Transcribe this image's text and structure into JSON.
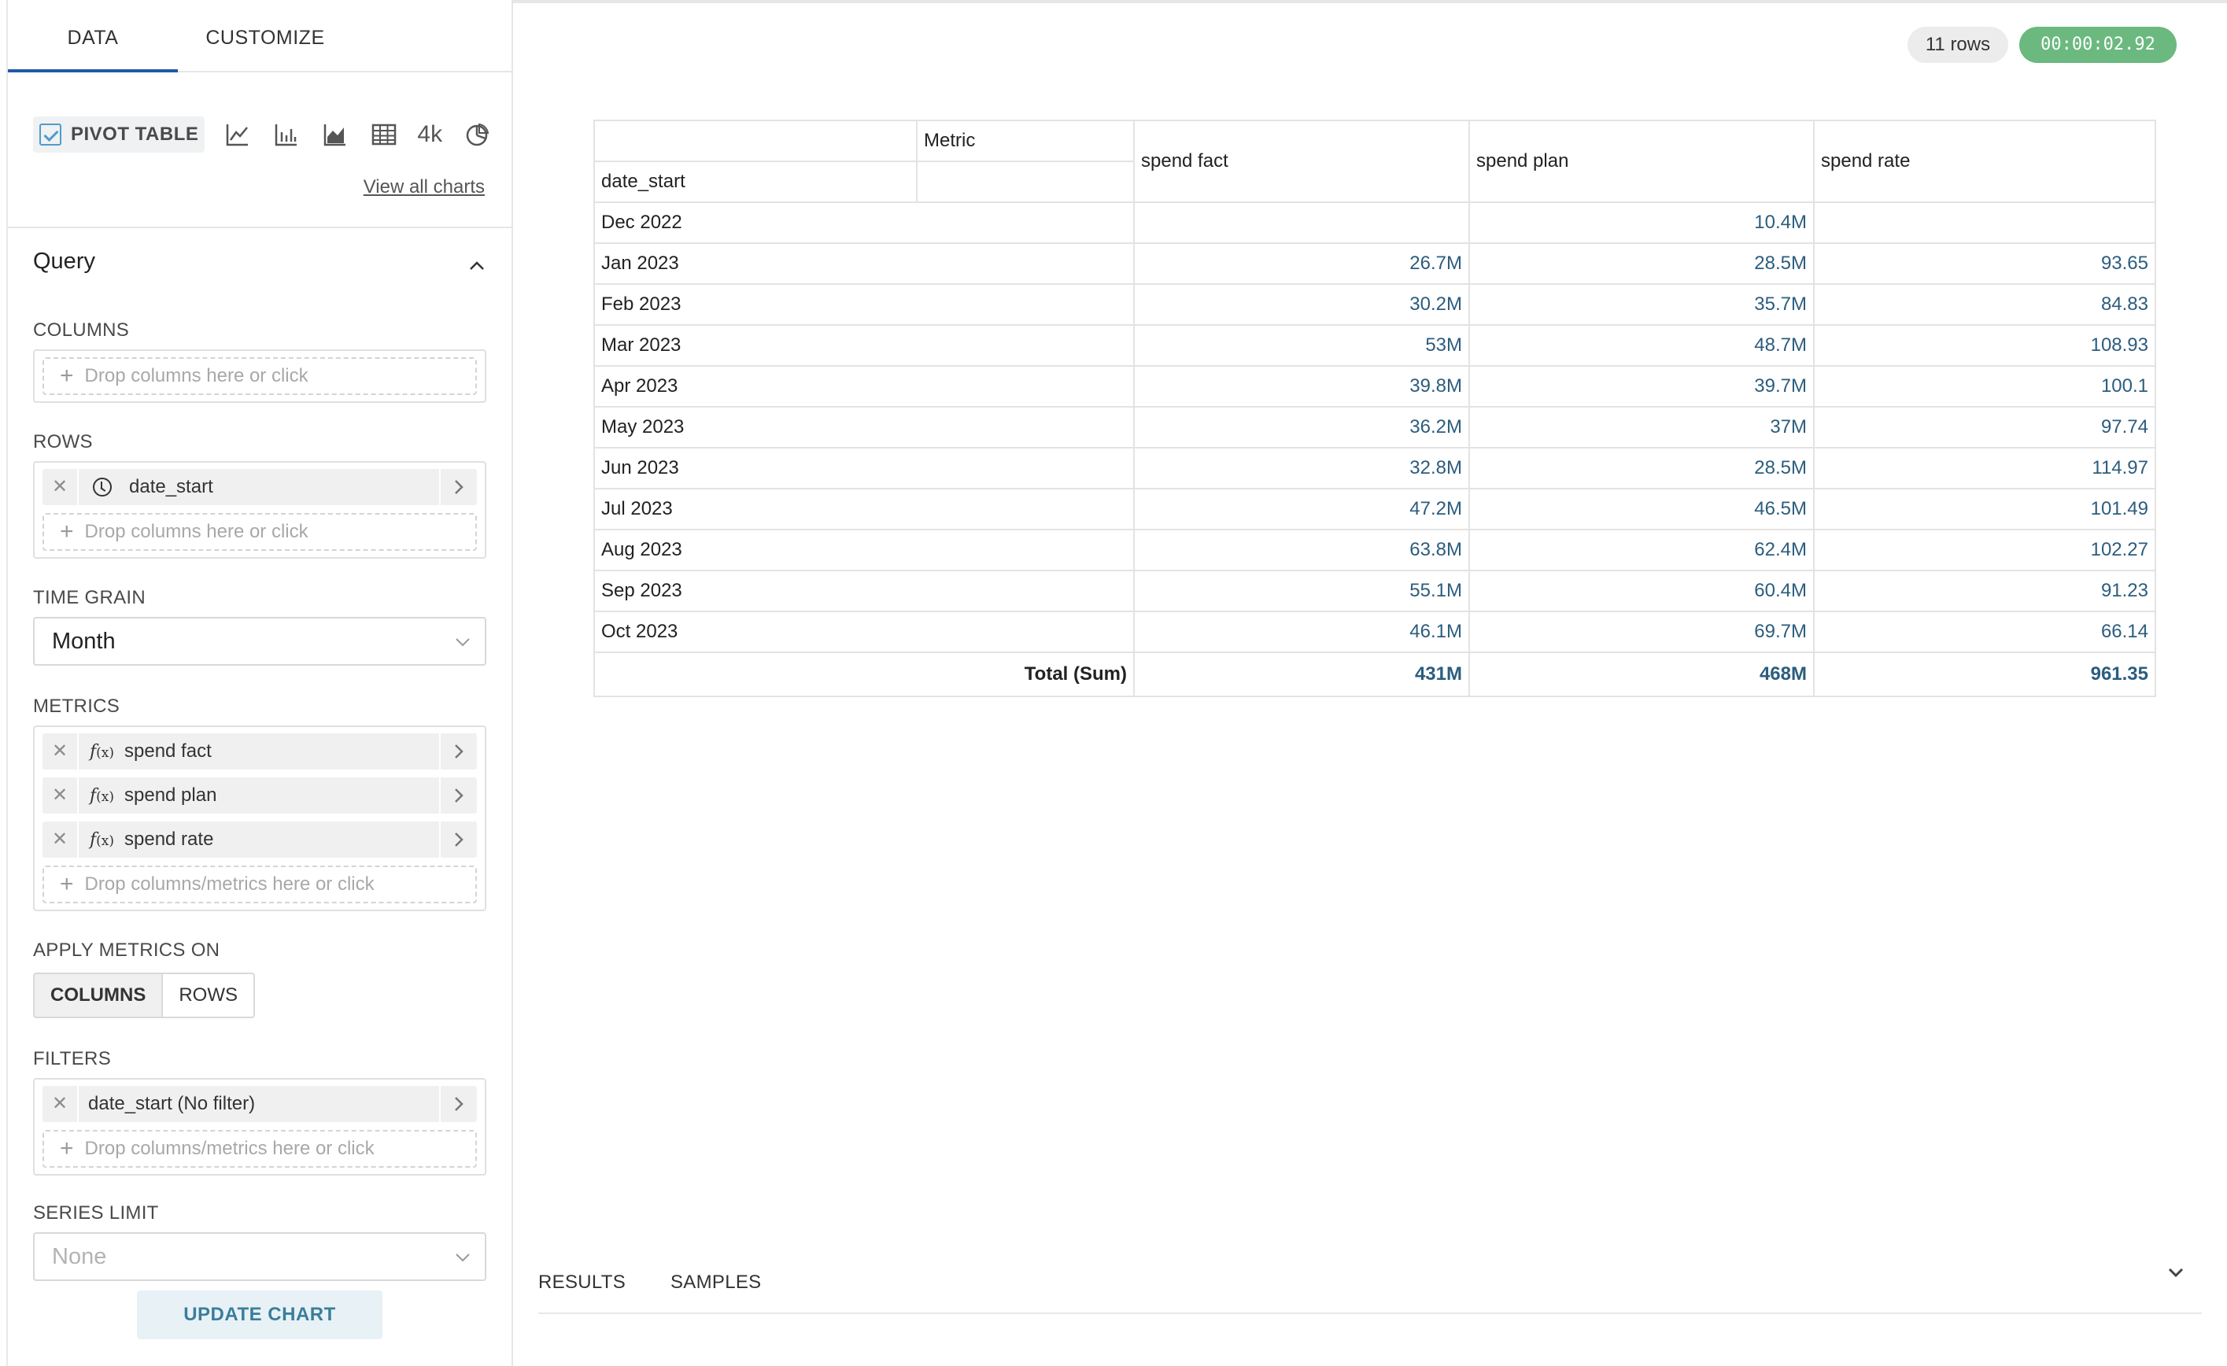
{
  "tabs": {
    "data": "DATA",
    "customize": "CUSTOMIZE"
  },
  "chart_types": {
    "pivot_label": "PIVOT TABLE",
    "icons": [
      "line-chart-icon",
      "bar-chart-icon",
      "area-chart-icon",
      "table-icon",
      "big-number-4k-icon",
      "pie-chart-icon"
    ],
    "big_number_label": "4k",
    "view_all": "View all charts"
  },
  "query": {
    "title": "Query",
    "columns": {
      "label": "COLUMNS",
      "drop": "Drop columns here or click"
    },
    "rows": {
      "label": "ROWS",
      "item": "date_start",
      "drop": "Drop columns here or click"
    },
    "time_grain": {
      "label": "TIME GRAIN",
      "value": "Month"
    },
    "metrics": {
      "label": "METRICS",
      "fx": "f",
      "fx_sub": "(x)",
      "items": [
        "spend fact",
        "spend plan",
        "spend rate"
      ],
      "drop": "Drop columns/metrics here or click"
    },
    "apply_metrics": {
      "label": "APPLY METRICS ON",
      "options": [
        "COLUMNS",
        "ROWS"
      ],
      "selected": "COLUMNS"
    },
    "filters": {
      "label": "FILTERS",
      "item": "date_start (No filter)",
      "drop": "Drop columns/metrics here or click"
    },
    "series_limit": {
      "label": "SERIES LIMIT",
      "placeholder": "None"
    },
    "update_button": "UPDATE CHART"
  },
  "status": {
    "rows": "11 rows",
    "time": "00:00:02.92"
  },
  "pivot_table": {
    "metric_header": "Metric",
    "row_header": "date_start",
    "columns": [
      "spend fact",
      "spend plan",
      "spend rate"
    ],
    "rows": [
      {
        "label": "Dec 2022",
        "values": [
          "",
          "10.4M",
          ""
        ]
      },
      {
        "label": "Jan 2023",
        "values": [
          "26.7M",
          "28.5M",
          "93.65"
        ]
      },
      {
        "label": "Feb 2023",
        "values": [
          "30.2M",
          "35.7M",
          "84.83"
        ]
      },
      {
        "label": "Mar 2023",
        "values": [
          "53M",
          "48.7M",
          "108.93"
        ]
      },
      {
        "label": "Apr 2023",
        "values": [
          "39.8M",
          "39.7M",
          "100.1"
        ]
      },
      {
        "label": "May 2023",
        "values": [
          "36.2M",
          "37M",
          "97.74"
        ]
      },
      {
        "label": "Jun 2023",
        "values": [
          "32.8M",
          "28.5M",
          "114.97"
        ]
      },
      {
        "label": "Jul 2023",
        "values": [
          "47.2M",
          "46.5M",
          "101.49"
        ]
      },
      {
        "label": "Aug 2023",
        "values": [
          "63.8M",
          "62.4M",
          "102.27"
        ]
      },
      {
        "label": "Sep 2023",
        "values": [
          "55.1M",
          "60.4M",
          "91.23"
        ]
      },
      {
        "label": "Oct 2023",
        "values": [
          "46.1M",
          "69.7M",
          "66.14"
        ]
      }
    ],
    "total": {
      "label": "Total (Sum)",
      "values": [
        "431M",
        "468M",
        "961.35"
      ]
    }
  },
  "bottom_tabs": [
    "RESULTS",
    "SAMPLES"
  ]
}
